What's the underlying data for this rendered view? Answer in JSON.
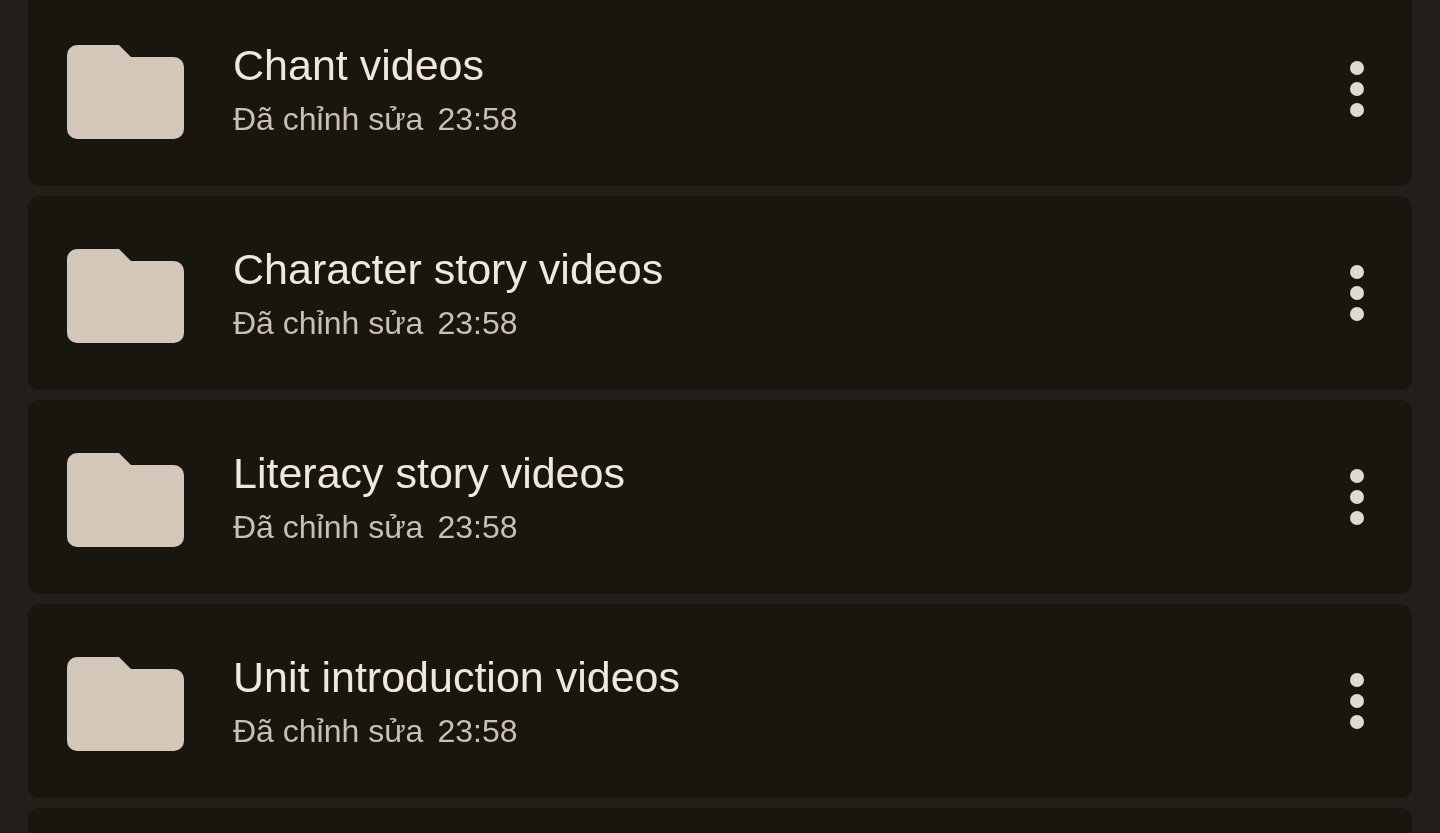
{
  "folders": [
    {
      "name": "Chant videos",
      "status": "Đã chỉnh sửa",
      "time": "23:58"
    },
    {
      "name": "Character story videos",
      "status": "Đã chỉnh sửa",
      "time": "23:58"
    },
    {
      "name": "Literacy story videos",
      "status": "Đã chỉnh sửa",
      "time": "23:58"
    },
    {
      "name": "Unit introduction videos",
      "status": "Đã chỉnh sửa",
      "time": "23:58"
    }
  ]
}
